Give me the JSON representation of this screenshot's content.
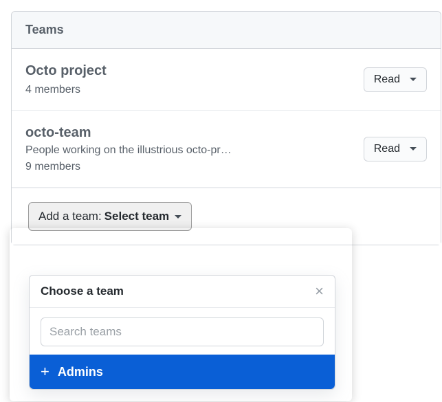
{
  "panel": {
    "title": "Teams"
  },
  "teams": [
    {
      "name": "Octo project",
      "description": "",
      "members": "4 members",
      "permission": "Read"
    },
    {
      "name": "octo-team",
      "description": "People working on the illustrious octo-pr…",
      "members": "9 members",
      "permission": "Read"
    }
  ],
  "add": {
    "prefix": "Add a team:",
    "selected": "Select team"
  },
  "popover": {
    "title": "Choose a team",
    "search_placeholder": "Search teams",
    "items": [
      {
        "label": "Admins"
      }
    ]
  }
}
